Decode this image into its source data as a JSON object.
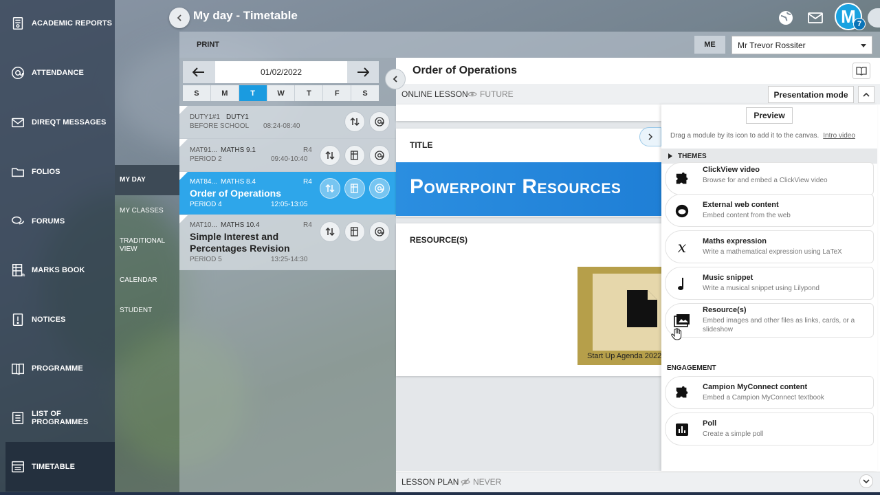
{
  "leftnav": {
    "items": [
      {
        "label": "ACADEMIC REPORTS",
        "icon": "report-icon"
      },
      {
        "label": "ATTENDANCE",
        "icon": "at-icon"
      },
      {
        "label": "DIREQT MESSAGES",
        "icon": "message-icon"
      },
      {
        "label": "FOLIOS",
        "icon": "folder-icon"
      },
      {
        "label": "FORUMS",
        "icon": "forum-icon"
      },
      {
        "label": "MARKS BOOK",
        "icon": "marks-icon"
      },
      {
        "label": "NOTICES",
        "icon": "notice-icon"
      },
      {
        "label": "PROGRAMME",
        "icon": "programme-icon"
      },
      {
        "label": "LIST OF PROGRAMMES",
        "icon": "list-icon"
      },
      {
        "label": "TIMETABLE",
        "icon": "timetable-icon"
      }
    ]
  },
  "subnav": {
    "items": [
      "MY DAY",
      "MY CLASSES",
      "TRADITIONAL VIEW",
      "CALENDAR",
      "STUDENT"
    ]
  },
  "header": {
    "title": "My day - Timetable",
    "avatar_letter": "M",
    "avatar_badge": "7"
  },
  "toolbar": {
    "print": "PRINT",
    "me": "ME",
    "teacher": "Mr Trevor Rossiter"
  },
  "timetable": {
    "date": "01/02/2022",
    "days": [
      "S",
      "M",
      "T",
      "W",
      "T",
      "F",
      "S"
    ],
    "lessons": [
      {
        "code": "DUTY1#1",
        "subject": "DUTY1",
        "room": "",
        "title": "",
        "period": "BEFORE  SCHOOL",
        "time": "08:24-08:40"
      },
      {
        "code": "MAT91...",
        "subject": "MATHS 9.1",
        "room": "R4",
        "title": "",
        "period": "PERIOD 2",
        "time": "09:40-10:40"
      },
      {
        "code": "MAT84...",
        "subject": "MATHS 8.4",
        "room": "R4",
        "title": "Order of Operations",
        "period": "PERIOD 4",
        "time": "12:05-13:05"
      },
      {
        "code": "MAT10...",
        "subject": "MATHS  10.4",
        "room": "R4",
        "title": "Simple Interest and Percentages Revision",
        "period": "PERIOD 5",
        "time": "13:25-14:30"
      }
    ]
  },
  "main": {
    "title": "Order of Operations",
    "status": "ONLINE LESSON",
    "visibility": "FUTURE",
    "presentation_mode": "Presentation mode",
    "title_card": "TITLE",
    "banner": "Powerpoint Resources",
    "resources_card": "RESOURCE(S)",
    "resource_caption": "Start Up Agenda 2022",
    "lesson_plan": "LESSON PLAN",
    "lesson_plan_visibility": "NEVER"
  },
  "modules": {
    "preview": "Preview",
    "hint": "Drag a module by its icon to add it to the canvas.",
    "intro_link": "Intro video",
    "themes": "THEMES",
    "items": [
      {
        "title": "ClickView video",
        "desc": "Browse for and embed a ClickView video"
      },
      {
        "title": "External web content",
        "desc": "Embed content from the web"
      },
      {
        "title": "Maths expression",
        "desc": "Write a mathematical expression using LaTeX"
      },
      {
        "title": "Music snippet",
        "desc": "Write a musical snippet using Lilypond"
      },
      {
        "title": "Resource(s)",
        "desc": "Embed images and other files as links, cards, or a slideshow"
      }
    ],
    "engagement": "ENGAGEMENT",
    "engagement_items": [
      {
        "title": "Campion MyConnect content",
        "desc": "Embed a Campion MyConnect textbook"
      },
      {
        "title": "Poll",
        "desc": "Create a simple poll"
      }
    ]
  },
  "colors": {
    "accent": "#1a9be0",
    "banner": "#2b8ee0",
    "nav": "#2c3a4e"
  }
}
